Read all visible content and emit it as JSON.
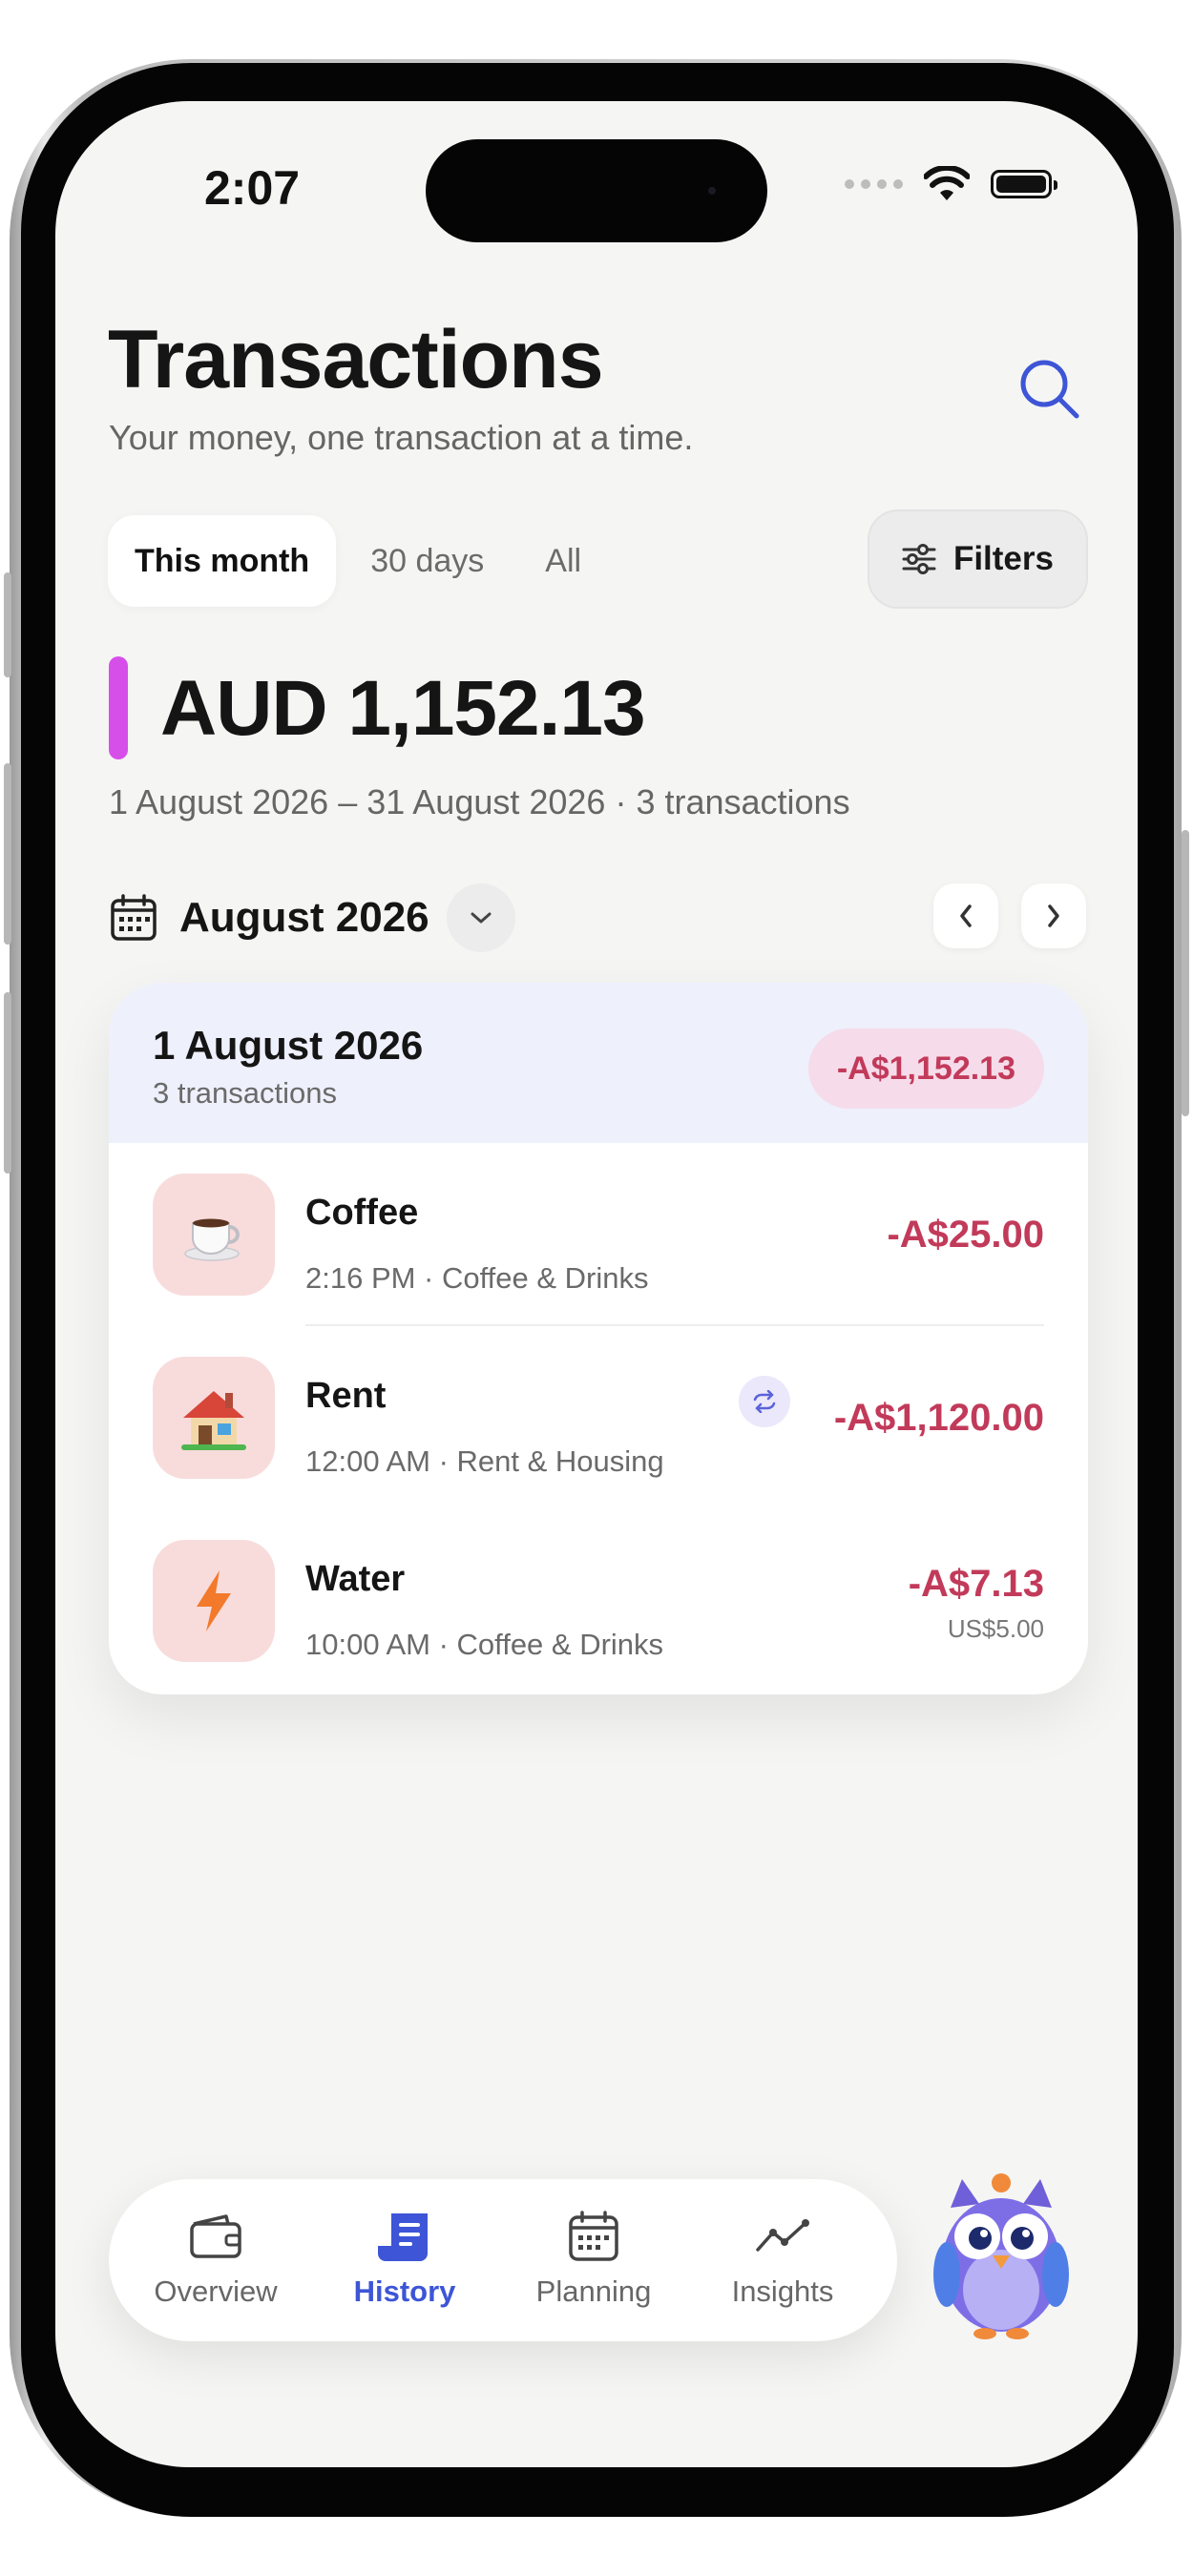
{
  "status_bar": {
    "time": "2:07"
  },
  "header": {
    "title": "Transactions",
    "subtitle": "Your money, one transaction at a time.",
    "search_icon": "search-icon"
  },
  "period_tabs": [
    {
      "label": "This month",
      "active": true
    },
    {
      "label": "30 days",
      "active": false
    },
    {
      "label": "All",
      "active": false
    }
  ],
  "filters": {
    "label": "Filters",
    "icon": "sliders-icon"
  },
  "summary": {
    "total": "AUD 1,152.13",
    "range": "1 August 2026 – 31 August 2026 · 3 transactions",
    "accent_color": "#d64fe8"
  },
  "month_nav": {
    "label": "August 2026",
    "icon": "calendar-icon"
  },
  "day_group": {
    "title": "1 August 2026",
    "count": "3 transactions",
    "total": "-A$1,152.13",
    "transactions": [
      {
        "name": "Coffee",
        "meta": "2:16 PM · Coffee & Drinks",
        "amount": "-A$25.00",
        "icon": "coffee-cup-icon"
      },
      {
        "name": "Rent",
        "meta": "12:00 AM · Rent & Housing",
        "amount": "-A$1,120.00",
        "icon": "house-icon",
        "recurring": true
      },
      {
        "name": "Water",
        "meta": "10:00 AM · Coffee & Drinks",
        "amount": "-A$7.13",
        "secondary_amount": "US$5.00",
        "icon": "lightning-icon"
      }
    ]
  },
  "tab_bar": {
    "items": [
      {
        "label": "Overview",
        "icon": "wallet-icon",
        "active": false
      },
      {
        "label": "History",
        "icon": "receipt-icon",
        "active": true
      },
      {
        "label": "Planning",
        "icon": "calendar-icon",
        "active": false
      },
      {
        "label": "Insights",
        "icon": "trend-line-icon",
        "active": false
      }
    ],
    "active_color": "#3d55d6"
  },
  "colors": {
    "negative_amount": "#c23a5a",
    "background": "#f5f5f4"
  }
}
